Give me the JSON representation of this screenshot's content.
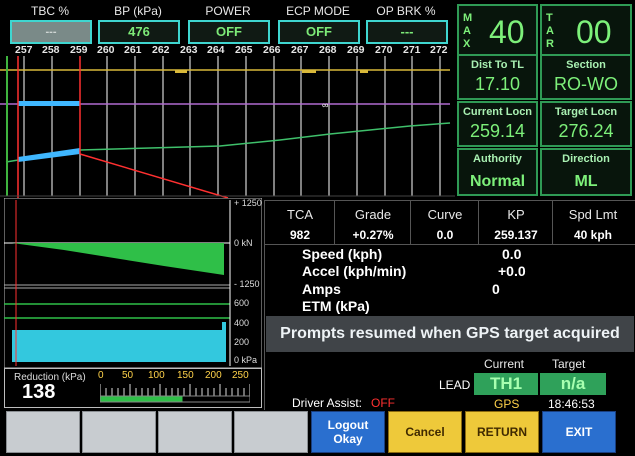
{
  "top_status": [
    {
      "label": "TBC %",
      "value": "---"
    },
    {
      "label": "BP (kPa)",
      "value": "476"
    },
    {
      "label": "POWER",
      "value": "OFF"
    },
    {
      "label": "ECP MODE",
      "value": "OFF"
    },
    {
      "label": "OP BRK %",
      "value": "---"
    }
  ],
  "km_ticks": [
    "257",
    "258",
    "259",
    "260",
    "261",
    "262",
    "263",
    "264",
    "265",
    "266",
    "267",
    "268",
    "269",
    "270",
    "271",
    "272"
  ],
  "max_tar": {
    "max_letters": [
      "M",
      "A",
      "X"
    ],
    "max_value": "40",
    "tar_letters": [
      "T",
      "A",
      "R"
    ],
    "tar_value": "00"
  },
  "right_panel": [
    {
      "title": "Dist To TL",
      "value": "17.10"
    },
    {
      "title": "Section",
      "value": "RO-WO"
    },
    {
      "title": "Current Locn",
      "value": "259.14"
    },
    {
      "title": "Target Locn",
      "value": "276.24"
    },
    {
      "title": "Authority",
      "value": "Normal"
    },
    {
      "title": "Direction",
      "value": "ML"
    }
  ],
  "force_axis": [
    "+ 1250",
    "0 kN",
    "- 1250"
  ],
  "pressure_axis": [
    "600",
    "400",
    "200",
    "0 kPa"
  ],
  "stats": {
    "headers": [
      "TCA",
      "Grade",
      "Curve",
      "KP",
      "Spd Lmt"
    ],
    "values": [
      "982",
      "+0.27%",
      "0.0",
      "259.137",
      "40 kph"
    ]
  },
  "readouts": [
    {
      "label": "Speed  (kph)",
      "value": "0.0"
    },
    {
      "label": "Accel  (kph/min)",
      "value": "+0.0"
    },
    {
      "label": "Amps",
      "value": "0"
    },
    {
      "label": "ETM (kPa)",
      "value": ""
    }
  ],
  "prompt": "Prompts resumed when GPS target acquired",
  "reduction": {
    "label": "Reduction (kPa)",
    "value": "138",
    "ticks": [
      "0",
      "50",
      "100",
      "150",
      "200",
      "250"
    ],
    "fraction": 0.55
  },
  "lead": {
    "lead_label": "LEAD",
    "current_header": "Current",
    "target_header": "Target",
    "current": "TH1",
    "target": "n/a",
    "source": "GPS",
    "time": "18:46:53"
  },
  "driver_assist": {
    "label": "Driver Assist:",
    "value": "OFF"
  },
  "buttons": {
    "logout": "Logout\nOkay",
    "cancel": "Cancel",
    "return": "RETURN",
    "exit": "EXIT"
  },
  "colors": {
    "accent_green": "#7df07a",
    "border_cyan": "#3fd6d0",
    "button_blue": "#2a6fcf",
    "button_yellow": "#eec93a",
    "alert_red": "#ff3030"
  }
}
